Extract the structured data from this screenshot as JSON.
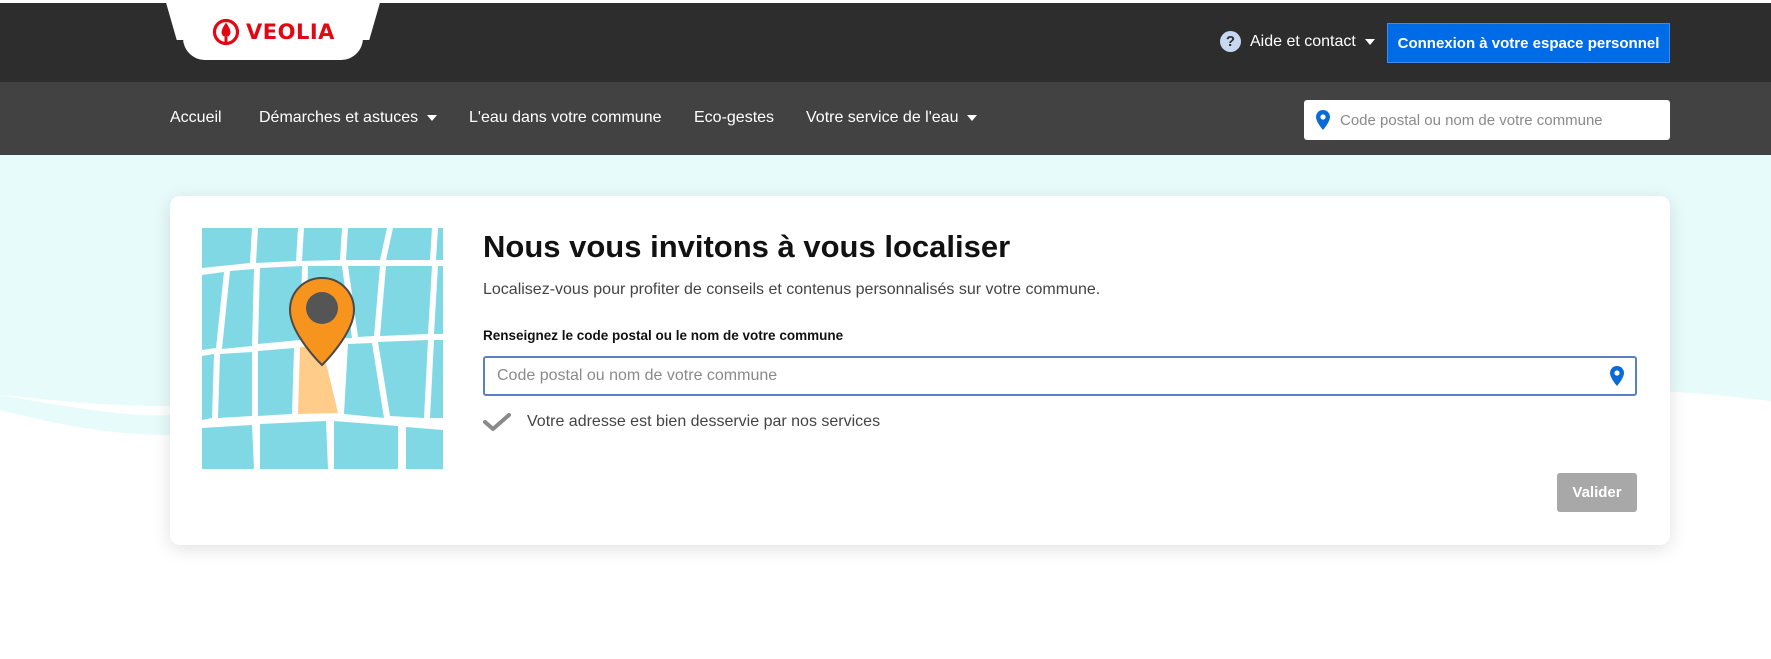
{
  "brand": {
    "name": "VEOLIA",
    "color": "#e30613"
  },
  "header": {
    "help_label": "Aide et contact",
    "connect_label": "Connexion à votre espace personnel"
  },
  "nav": {
    "items": [
      {
        "label": "Accueil",
        "has_dropdown": false
      },
      {
        "label": "Démarches et astuces",
        "has_dropdown": true
      },
      {
        "label": "L'eau dans votre commune",
        "has_dropdown": false
      },
      {
        "label": "Eco-gestes",
        "has_dropdown": false
      },
      {
        "label": "Votre service de l'eau",
        "has_dropdown": true
      }
    ],
    "search_placeholder": "Code postal ou nom de votre commune"
  },
  "locate": {
    "title": "Nous vous invitons à vous localiser",
    "subtitle": "Localisez-vous pour profiter de conseils et contenus personnalisés sur votre commune.",
    "field_label": "Renseignez le code postal ou le nom de votre commune",
    "field_value": "",
    "field_placeholder": "Code postal ou nom de votre commune",
    "status_text": "Votre adresse est bien desservie par nos services",
    "submit_label": "Valider"
  },
  "icons": [
    "veolia-logo-icon",
    "help-icon",
    "chevron-down-icon",
    "location-pin-icon",
    "checkmark-icon",
    "map-illustration"
  ],
  "colors": {
    "topbar": "#2d2d2d",
    "navbar": "#424242",
    "primary_button": "#006be6",
    "disabled_button": "#a8a8a8",
    "hero_background": "#e8fbfb",
    "pin": "#0a6ad6",
    "map_pin": "#f7941d"
  }
}
